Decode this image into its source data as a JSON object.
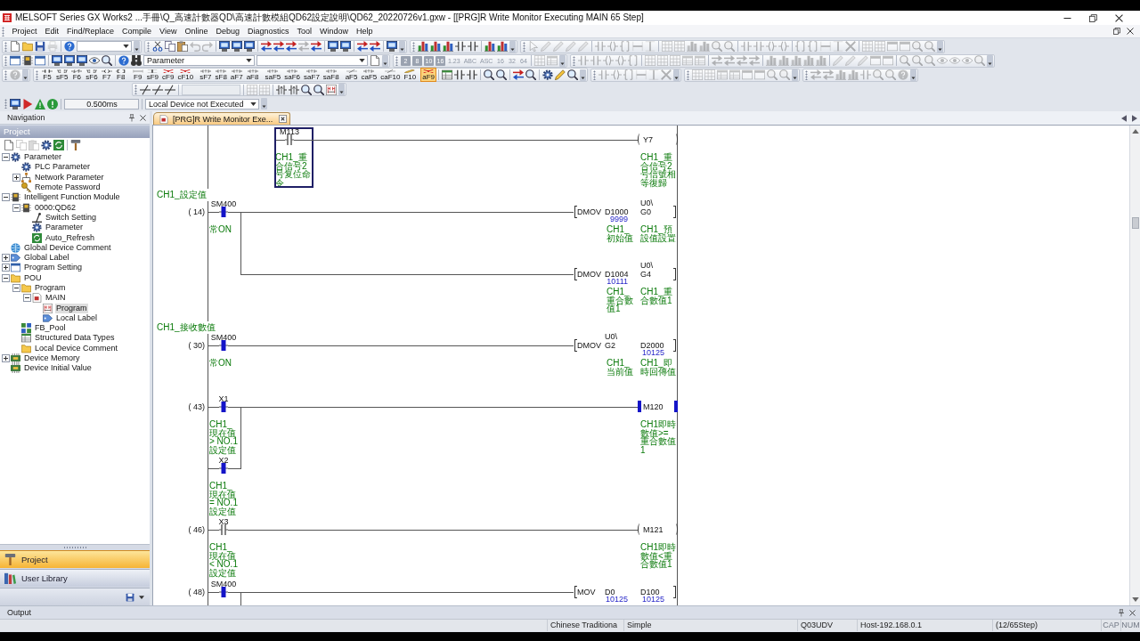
{
  "window": {
    "title": "MELSOFT Series GX Works2 ...手冊\\Q_高速計數器QD\\高速計數模組QD62設定說明\\QD62_20220726v1.gxw - [[PRG]R Write Monitor Executing MAIN 65 Step]"
  },
  "menu": [
    "Project",
    "Edit",
    "Find/Replace",
    "Compile",
    "View",
    "Online",
    "Debug",
    "Diagnostics",
    "Tool",
    "Window",
    "Help"
  ],
  "toolbars": {
    "find_combo": {
      "value": "Parameter"
    },
    "format_buttons": [
      {
        "label": "2",
        "kind": "radix",
        "disabled": true
      },
      {
        "label": "8",
        "kind": "radix",
        "disabled": true
      },
      {
        "label": "10",
        "kind": "radix",
        "disabled": true
      },
      {
        "label": "16",
        "kind": "radix",
        "disabled": true
      },
      {
        "label": "1.23",
        "kind": "format",
        "disabled": true
      },
      {
        "label": "ABC",
        "kind": "format",
        "disabled": true
      },
      {
        "label": "ASC",
        "kind": "format",
        "disabled": true
      },
      {
        "label": "16",
        "kind": "format",
        "disabled": true
      },
      {
        "label": "32",
        "kind": "format",
        "disabled": true
      },
      {
        "label": "64",
        "kind": "format",
        "disabled": true
      }
    ],
    "ladder_tools": [
      {
        "label": "F5",
        "kind": "contact",
        "selected": false
      },
      {
        "label": "sF5",
        "kind": "parallel",
        "selected": false
      },
      {
        "label": "F6",
        "kind": "closed",
        "selected": false
      },
      {
        "label": "sF6",
        "kind": "parallel",
        "selected": false
      },
      {
        "label": "F7",
        "kind": "coil",
        "selected": false
      },
      {
        "label": "F8",
        "kind": "instruction",
        "selected": false
      },
      {
        "label": "F9",
        "kind": "hline",
        "selected": false
      },
      {
        "label": "sF9",
        "kind": "vline",
        "selected": false
      },
      {
        "label": "cF9",
        "kind": "delete",
        "selected": false
      },
      {
        "label": "cF10",
        "kind": "delete",
        "selected": false
      },
      {
        "label": "sF7",
        "kind": "pulse",
        "selected": false
      },
      {
        "label": "sF8",
        "kind": "pulse",
        "selected": false
      },
      {
        "label": "aF7",
        "kind": "pulse",
        "selected": false
      },
      {
        "label": "aF8",
        "kind": "pulse",
        "selected": false
      },
      {
        "label": "saF5",
        "kind": "pulse",
        "selected": false
      },
      {
        "label": "saF6",
        "kind": "pulse",
        "selected": false
      },
      {
        "label": "saF7",
        "kind": "pulse",
        "selected": false
      },
      {
        "label": "saF8",
        "kind": "pulse",
        "selected": false
      },
      {
        "label": "aF5",
        "kind": "invert",
        "selected": false
      },
      {
        "label": "caF5",
        "kind": "pulse",
        "selected": false
      },
      {
        "label": "caF10",
        "kind": "invert",
        "selected": false
      },
      {
        "label": "F10",
        "kind": "draw",
        "selected": false
      },
      {
        "label": "aF9",
        "kind": "delete",
        "selected": true
      }
    ],
    "scan_time": {
      "value": "0.500ms"
    },
    "execution_combo": {
      "value": "Local Device not Executed"
    }
  },
  "navigation": {
    "title": "Navigation",
    "pane_title": "Project",
    "tree": [
      {
        "label": "Parameter",
        "kind": "parameter",
        "expanded": true,
        "selected": false,
        "children": [
          {
            "label": "PLC Parameter",
            "kind": "parameter",
            "selected": false
          },
          {
            "label": "Network Parameter",
            "kind": "network",
            "expanded": false,
            "selected": false
          },
          {
            "label": "Remote Password",
            "kind": "password",
            "selected": false
          }
        ]
      },
      {
        "label": "Intelligent Function Module",
        "kind": "module",
        "expanded": true,
        "selected": false,
        "children": [
          {
            "label": "0000:QD62",
            "kind": "module",
            "expanded": true,
            "selected": false,
            "children": [
              {
                "label": "Switch Setting",
                "kind": "switch",
                "selected": false
              },
              {
                "label": "Parameter",
                "kind": "parameter",
                "selected": false
              },
              {
                "label": "Auto_Refresh",
                "kind": "refresh",
                "selected": false
              }
            ]
          }
        ]
      },
      {
        "label": "Global Device Comment",
        "kind": "comment",
        "selected": false
      },
      {
        "label": "Global Label",
        "kind": "label",
        "expanded": false,
        "selected": false
      },
      {
        "label": "Program Setting",
        "kind": "setting",
        "expanded": false,
        "selected": false
      },
      {
        "label": "POU",
        "kind": "folder",
        "expanded": true,
        "selected": false,
        "children": [
          {
            "label": "Program",
            "kind": "folder",
            "expanded": true,
            "selected": false,
            "children": [
              {
                "label": "MAIN",
                "kind": "program",
                "expanded": true,
                "selected": false,
                "children": [
                  {
                    "label": "Program",
                    "kind": "ladder",
                    "selected": true
                  },
                  {
                    "label": "Local Label",
                    "kind": "label",
                    "selected": false
                  }
                ]
              }
            ]
          },
          {
            "label": "FB_Pool",
            "kind": "pool",
            "selected": false
          },
          {
            "label": "Structured Data Types",
            "kind": "struct",
            "selected": false
          },
          {
            "label": "Local Device Comment",
            "kind": "folder",
            "selected": false
          }
        ]
      },
      {
        "label": "Device Memory",
        "kind": "memory",
        "expanded": false,
        "selected": false
      },
      {
        "label": "Device Initial Value",
        "kind": "memory",
        "selected": false
      }
    ],
    "tabs": [
      {
        "label": "Project",
        "selected": true
      },
      {
        "label": "User Library",
        "selected": false
      }
    ]
  },
  "editor": {
    "tabs": [
      {
        "label": "[PRG]R Write Monitor Exe...",
        "selected": true
      }
    ],
    "ladder": {
      "rungs": [
        {
          "kind": "rung",
          "contacts": [
            {
              "device": "M113",
              "comment": "CH1_重合信号2号复位命令",
              "on": false,
              "selected": true
            }
          ],
          "outputs": [
            {
              "kind": "coil",
              "device": "Y7",
              "comment": "CH1_重合信号2号信號相等復歸",
              "on": false,
              "selected": false
            }
          ]
        },
        {
          "kind": "statement",
          "text": "CH1_設定值"
        },
        {
          "kind": "rung",
          "step": "( 14)",
          "contacts": [
            {
              "device": "SM400",
              "comment": "常ON",
              "on": true,
              "selected": false
            }
          ],
          "outputs": [
            {
              "kind": "instruction",
              "name": "DMOV",
              "selected": false,
              "operands": [
                {
                  "device": "D1000",
                  "value": "9999",
                  "comment": "CH1_初始值"
                },
                {
                  "prefix": "U0\\",
                  "device": "G0",
                  "comment": "CH1_預設值設置"
                }
              ]
            },
            {
              "kind": "instruction",
              "name": "DMOV",
              "selected": false,
              "operands": [
                {
                  "device": "D1004",
                  "value": "10111",
                  "comment": "CH1_重合數值1"
                },
                {
                  "prefix": "U0\\",
                  "device": "G4",
                  "comment": "CH1_重合數值1"
                }
              ]
            }
          ]
        },
        {
          "kind": "statement",
          "text": "CH1_接收數值"
        },
        {
          "kind": "rung",
          "step": "( 30)",
          "contacts": [
            {
              "device": "SM400",
              "comment": "常ON",
              "on": true,
              "selected": false
            }
          ],
          "outputs": [
            {
              "kind": "instruction",
              "name": "DMOV",
              "selected": false,
              "operands": [
                {
                  "prefix": "U0\\",
                  "device": "G2",
                  "comment": "CH1_当前值"
                },
                {
                  "device": "D2000",
                  "value": "10125",
                  "comment": "CH1_即時回傳值"
                }
              ]
            }
          ]
        },
        {
          "kind": "rung",
          "step": "( 43)",
          "contacts": [
            {
              "device": "X1",
              "comment": "CH1_現在值 > NO.1 設定值",
              "on": true,
              "selected": false
            },
            {
              "device": "X2",
              "comment": "CH1_現在值 = NO.1 設定值",
              "on": true,
              "selected": false
            }
          ],
          "outputs": [
            {
              "kind": "coil",
              "device": "M120",
              "comment": "CH1即時數值>=重合數值1",
              "on": true,
              "selected": false
            }
          ]
        },
        {
          "kind": "rung",
          "step": "( 46)",
          "contacts": [
            {
              "device": "X3",
              "comment": "CH1_現在值 < NO.1 設定值",
              "on": false,
              "selected": false
            }
          ],
          "outputs": [
            {
              "kind": "coil",
              "device": "M121",
              "comment": "CH1即時數值<重合數值1",
              "on": false,
              "selected": false
            }
          ]
        },
        {
          "kind": "rung",
          "step": "( 48)",
          "contacts": [
            {
              "device": "SM400",
              "on": true,
              "selected": false
            }
          ],
          "outputs": [
            {
              "kind": "instruction",
              "name": "MOV",
              "selected": false,
              "operands": [
                {
                  "device": "D0",
                  "value": "10125"
                },
                {
                  "device": "D100",
                  "value": "10125"
                }
              ]
            }
          ]
        }
      ]
    }
  },
  "output_panel": {
    "title": "Output"
  },
  "status_bar": {
    "fields": [
      "Chinese Traditiona",
      "Simple",
      "Q03UDV",
      "Host-192.168.0.1",
      "(12/65Step)"
    ],
    "indicators": [
      {
        "label": "CAP",
        "on": false
      },
      {
        "label": "NUM",
        "on": false
      }
    ]
  }
}
